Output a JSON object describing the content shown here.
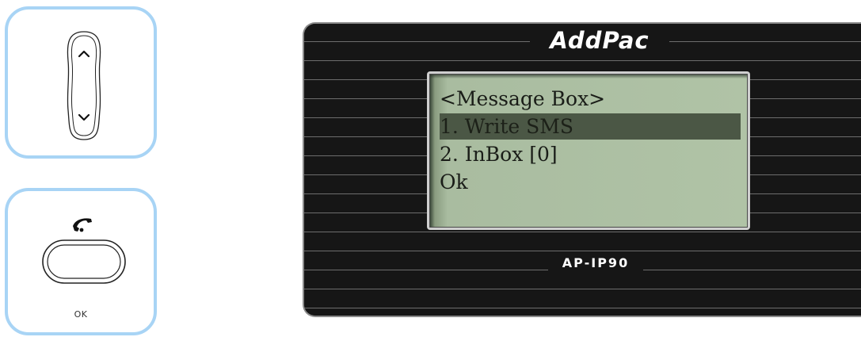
{
  "nav_keypad": {
    "up_icon": "chevron-up-icon",
    "down_icon": "chevron-down-icon"
  },
  "ok_keypad": {
    "phone_icon": "phone-handset-icon",
    "ok_label": "OK"
  },
  "display": {
    "brand": "AddPac",
    "model": "AP-IP90",
    "lcd_lines": [
      "<Message Box>",
      "1. Write SMS",
      "2. InBox [0]",
      "Ok"
    ],
    "selected_index": 1
  },
  "colors": {
    "panel_border": "#a8d4f5",
    "lcd_background": "#b0c3a6",
    "lcd_highlight": "#4b5745",
    "body": "#1c1c1c"
  }
}
